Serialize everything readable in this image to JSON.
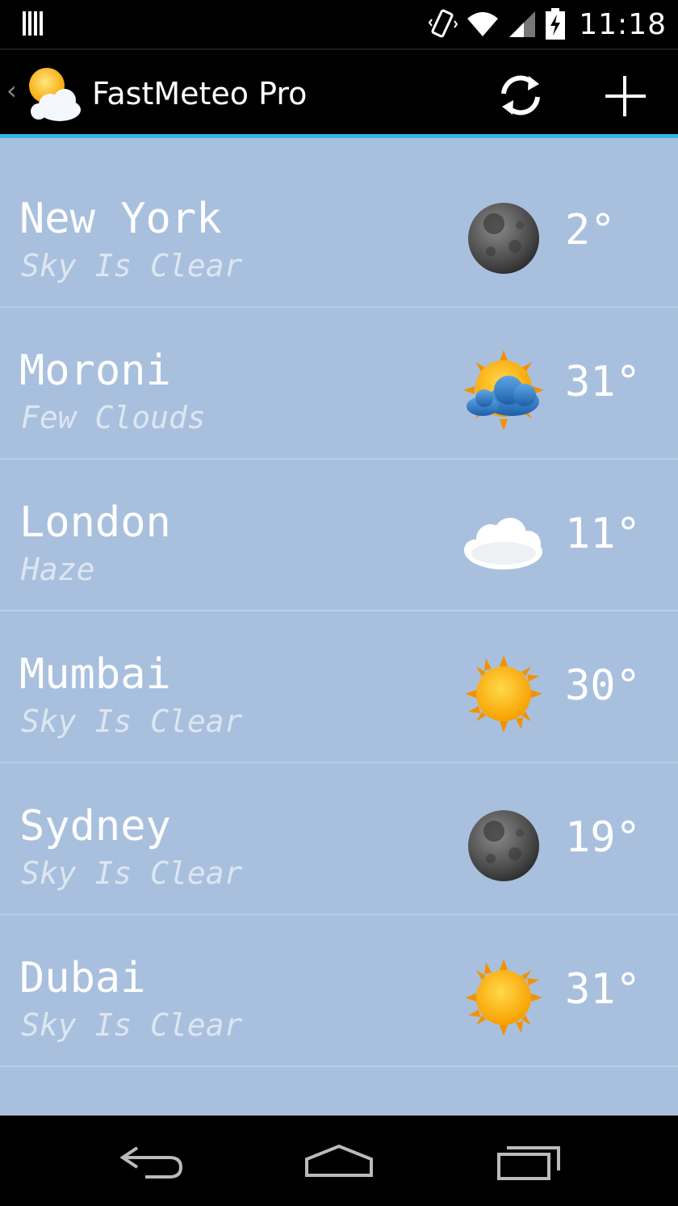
{
  "status_bar": {
    "time": "11:18"
  },
  "action_bar": {
    "title": "FastMeteo Pro",
    "icons": [
      "app-weather-icon",
      "refresh-icon",
      "add-icon"
    ]
  },
  "cities": [
    {
      "name": "New York",
      "description": "Sky Is Clear",
      "temperature": "2°",
      "icon": "moon-icon"
    },
    {
      "name": "Moroni",
      "description": "Few Clouds",
      "temperature": "31°",
      "icon": "sun-cloud-icon"
    },
    {
      "name": "London",
      "description": "Haze",
      "temperature": "11°",
      "icon": "cloud-icon"
    },
    {
      "name": "Mumbai",
      "description": "Sky Is Clear",
      "temperature": "30°",
      "icon": "sun-icon"
    },
    {
      "name": "Sydney",
      "description": "Sky Is Clear",
      "temperature": "19°",
      "icon": "moon-icon"
    },
    {
      "name": "Dubai",
      "description": "Sky Is Clear",
      "temperature": "31°",
      "icon": "sun-icon"
    }
  ],
  "colors": {
    "accent": "#33b5e5",
    "list_background": "#a8c0de",
    "description_text": "#dde6f0"
  },
  "nav_bar": {
    "icons": [
      "back-icon",
      "home-icon",
      "recent-apps-icon"
    ]
  }
}
